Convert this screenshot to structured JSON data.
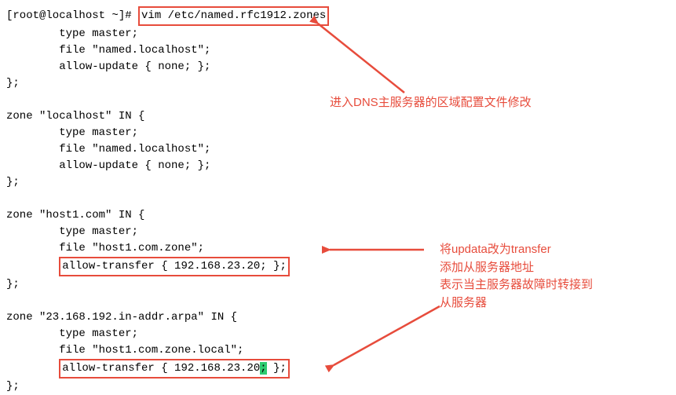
{
  "terminal": {
    "prompt": "[root@localhost ~]# ",
    "command": "vim /etc/named.rfc1912.zones",
    "block1": {
      "l1": "        type master;",
      "l2": "        file \"named.localhost\";",
      "l3": "        allow-update { none; };",
      "l4": "};"
    },
    "block2": {
      "l1": "zone \"localhost\" IN {",
      "l2": "        type master;",
      "l3": "        file \"named.localhost\";",
      "l4": "        allow-update { none; };",
      "l5": "};"
    },
    "block3": {
      "l1": "zone \"host1.com\" IN {",
      "l2": "        type master;",
      "l3": "        file \"host1.com.zone\";",
      "l4_hl": "allow-transfer { 192.168.23.20; };",
      "l5": "};"
    },
    "block4": {
      "l1": "zone \"23.168.192.in-addr.arpa\" IN {",
      "l2": "        type master;",
      "l3": "        file \"host1.com.zone.local\";",
      "l4_prefix": "allow-transfer { 192.168.23.20",
      "l4_cursor": ";",
      "l4_suffix": " };",
      "l5": "};"
    }
  },
  "annotations": {
    "a1": "进入DNS主服务器的区域配置文件修改",
    "a2_l1": "将updata改为transfer",
    "a2_l2": "添加从服务器地址",
    "a2_l3": "表示当主服务器故障时转接到",
    "a2_l4": "从服务器"
  }
}
